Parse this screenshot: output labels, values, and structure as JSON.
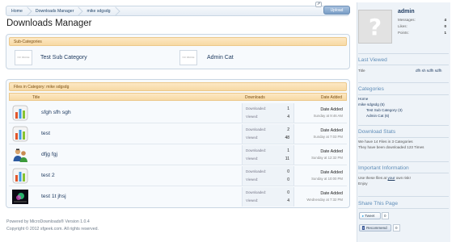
{
  "breadcrumb": [
    "Home",
    "Downloads Manager",
    "mike sdgsdg"
  ],
  "upload_label": "Upload",
  "page_title": "Downloads Manager",
  "subcategories": {
    "heading": "Sub-Categories",
    "thumb_text": "NO IMAGE",
    "items": [
      "Test Sub Category",
      "Admin Cat"
    ]
  },
  "files": {
    "heading": "Files in Category: mike sdgsdg",
    "columns": {
      "title": "Title",
      "downloads": "Downloads",
      "date": "Date Added"
    },
    "stat_labels": {
      "downloaded": "Downloaded:",
      "viewed": "Viewed:"
    },
    "date_label": "Date Added",
    "rows": [
      {
        "name": "sfgh sfh sgh",
        "downloaded": "1",
        "viewed": "4",
        "date": "Sunday at 9:46 AM",
        "icon": "bar-chart-icon"
      },
      {
        "name": "test",
        "downloaded": "2",
        "viewed": "48",
        "date": "Sunday at 7:03 PM",
        "icon": "bar-chart-icon"
      },
      {
        "name": "dfjg fgj",
        "downloaded": "1",
        "viewed": "11",
        "date": "Sunday at 12:32 PM",
        "icon": "users-icon"
      },
      {
        "name": "test 2",
        "downloaded": "0",
        "viewed": "0",
        "date": "Sunday at 10:00 PM",
        "icon": "bar-chart-icon"
      },
      {
        "name": "test 1t jhsj",
        "downloaded": "0",
        "viewed": "4",
        "date": "Wednesday at 7:32 PM",
        "icon": "image-icon"
      }
    ]
  },
  "footer": {
    "line1": "Powered by MicroDownloads® Version 1.0.4",
    "line2": "Copyright © 2012 sfgeek.com. All rights reserved."
  },
  "sidebar": {
    "username": "admin",
    "stats": [
      {
        "label": "Messages:",
        "value": "4"
      },
      {
        "label": "Likes:",
        "value": "0"
      },
      {
        "label": "Points:",
        "value": "1"
      }
    ],
    "last_viewed": {
      "title": "Last Viewed",
      "label": "Title",
      "value": "dfh sh sdfh sdfh"
    },
    "categories": {
      "title": "Categories",
      "items": [
        "Home",
        "mike sdgsdg (5)",
        "Test Sub Category (3)",
        "Admin Cat (6)"
      ]
    },
    "download_stats": {
      "title": "Download Stats",
      "line1": "We have 14 Files in 3 Categories",
      "line2": "They have been downloaded 123 Times"
    },
    "important": {
      "title": "Important Information",
      "line1_pre": "Use these files at ",
      "line1_link": "your",
      "line1_post": " own risk!",
      "line2": "Enjoy"
    },
    "share": {
      "title": "Share This Page",
      "tweet_label": "Tweet",
      "tweet_count": "0",
      "recommend_label": "Recommend",
      "recommend_count": "0"
    }
  },
  "colors": {
    "link": "#1f3b60",
    "sidebar_heading": "#5f8db8",
    "panel_header": "#f7d9a4"
  }
}
